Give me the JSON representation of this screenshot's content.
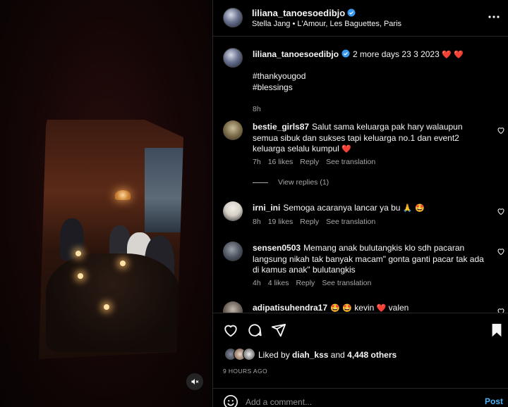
{
  "header": {
    "username": "liliana_tanoesoedibjo",
    "location": "Stella Jang • L'Amour, Les Baguettes, Paris"
  },
  "caption": {
    "username": "liliana_tanoesoedibjo",
    "text": "2 more days 23 3 2023",
    "hearts": "❤️ ❤️",
    "hashtag1": "#thankyougod",
    "hashtag2": "#blessings",
    "time": "8h"
  },
  "comments": [
    {
      "username": "bestie_girls87",
      "text": "Salut sama keluarga pak hary walaupun semua sibuk dan sukses tapi keluarga no.1 dan event2 keluarga selalu kumpul",
      "emoji": "❤️",
      "time": "7h",
      "likes": "16 likes",
      "reply": "Reply",
      "translate": "See translation"
    },
    {
      "username": "irni_ini",
      "text": "Semoga acaranya lancar ya bu",
      "emoji": "🙏 🤩",
      "time": "8h",
      "likes": "19 likes",
      "reply": "Reply",
      "translate": "See translation"
    },
    {
      "username": "sensen0503",
      "text": "Memang anak bulutangkis klo sdh pacaran langsung nikah tak banyak macam\" gonta ganti pacar tak ada di kamus anak\" bulutangkis",
      "time": "4h",
      "likes": "4 likes",
      "reply": "Reply",
      "translate": "See translation"
    },
    {
      "username": "adipatisuhendra17",
      "emoji1": "🤩 🤩",
      "text1": "kevin",
      "emoji2": "❤️",
      "text2": "valen"
    }
  ],
  "view_replies": "View replies (1)",
  "likes": {
    "prefix": "Liked by",
    "user": "diah_kss",
    "connector": "and",
    "others": "4,448 others"
  },
  "timestamp": "9 HOURS AGO",
  "comment_box": {
    "placeholder": "Add a comment...",
    "post_label": "Post"
  },
  "colors": {
    "accent": "#4cb5f9",
    "heart": "#ed3c3c",
    "verified": "#3897f0",
    "muted": "#a8a8a8"
  },
  "icons": [
    "more-icon",
    "verified-icon",
    "heart-icon",
    "comment-icon",
    "share-icon",
    "bookmark-icon",
    "emoji-icon",
    "mute-icon"
  ]
}
